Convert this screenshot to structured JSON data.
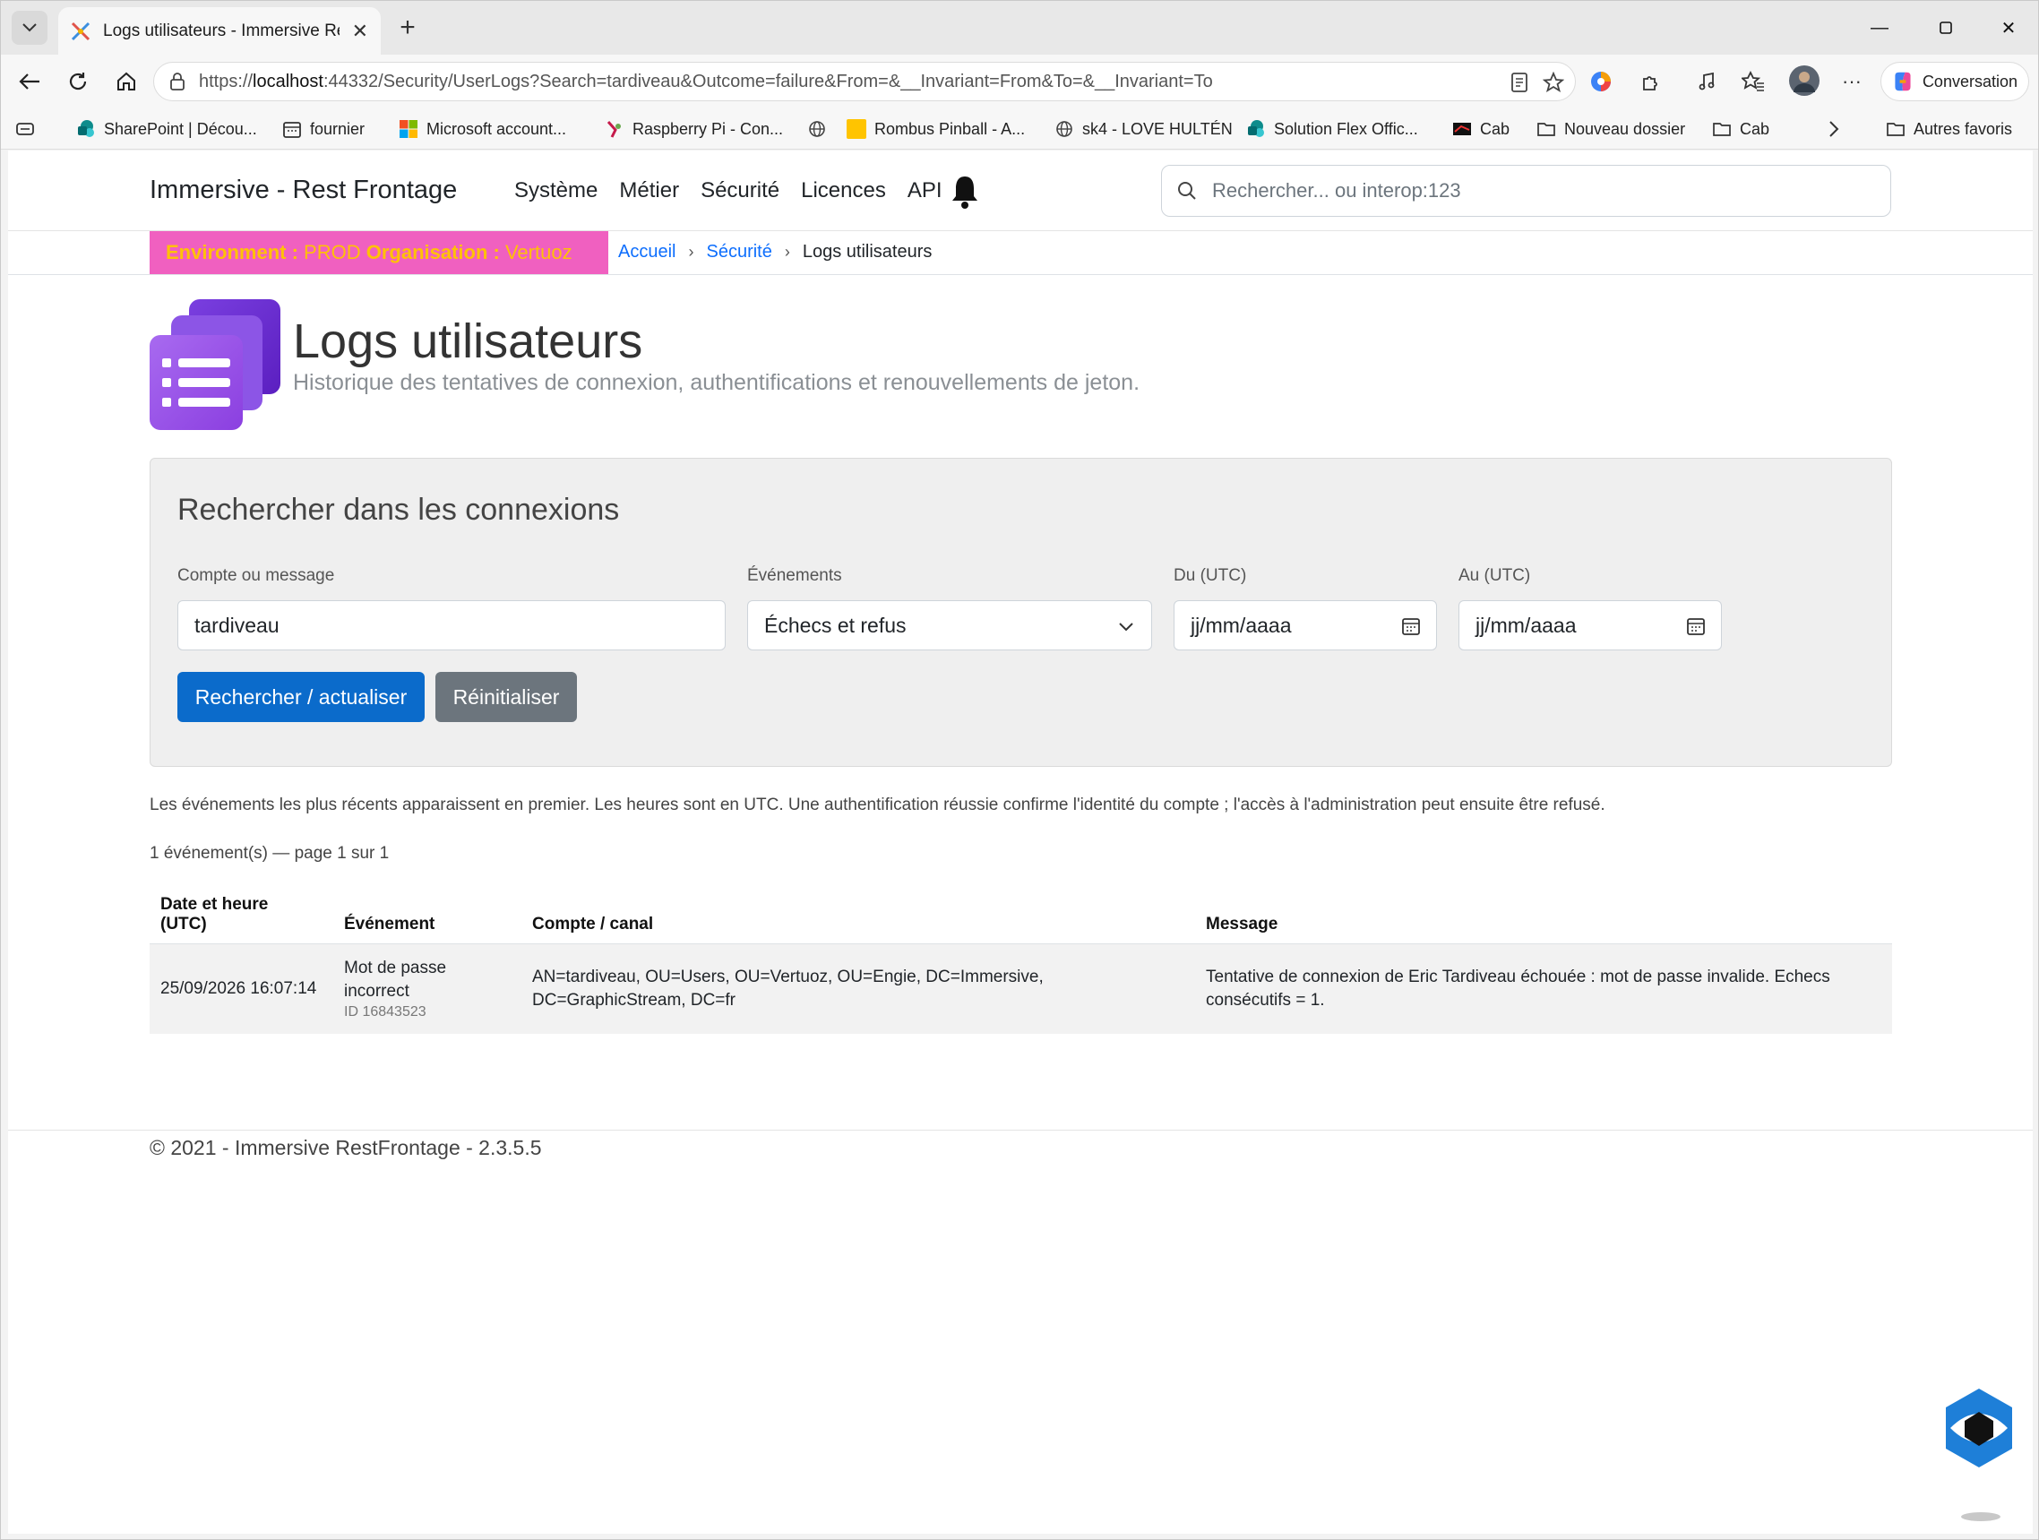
{
  "browser": {
    "tab_title": "Logs utilisateurs - Immersive RestF",
    "url_prefix": "https://",
    "url_host": "localhost",
    "url_rest": ":44332/Security/UserLogs?Search=tardiveau&Outcome=failure&From=&__Invariant=From&To=&__Invariant=To",
    "copilot_label": "Conversation",
    "bookmarks": [
      {
        "label": "SharePoint | Décou...",
        "icon": "sharepoint-icon"
      },
      {
        "label": "fournier",
        "icon": "calendar-icon"
      },
      {
        "label": "Microsoft account...",
        "icon": "microsoft-icon"
      },
      {
        "label": "Raspberry Pi - Con...",
        "icon": "raspberry-icon"
      },
      {
        "label": "",
        "icon": "globe-icon"
      },
      {
        "label": "Rombus Pinball - A...",
        "icon": "yellow-square-icon"
      },
      {
        "label": "sk4 - LOVE HULTÉN",
        "icon": "globe-icon"
      },
      {
        "label": "Solution Flex Offic...",
        "icon": "sharepoint-icon"
      },
      {
        "label": "Cab",
        "icon": "cab-icon"
      },
      {
        "label": "Nouveau dossier",
        "icon": "folder-icon"
      },
      {
        "label": "Cab",
        "icon": "folder-icon"
      }
    ],
    "other_bookmarks": "Autres favoris"
  },
  "app": {
    "brand": "Immersive - Rest Frontage",
    "nav": [
      "Système",
      "Métier",
      "Sécurité",
      "Licences",
      "API"
    ],
    "search_placeholder": "Rechercher... ou interop:123",
    "env_label": "Environment :",
    "env_value": "PROD",
    "org_label": "Organisation :",
    "org_value": "Vertuoz",
    "breadcrumb": [
      "Accueil",
      "Sécurité",
      "Logs utilisateurs"
    ]
  },
  "page": {
    "title": "Logs utilisateurs",
    "subtitle": "Historique des tentatives de connexion, authentifications et renouvellements de jeton."
  },
  "search": {
    "card_title": "Rechercher dans les connexions",
    "account_label": "Compte ou message",
    "account_value": "tardiveau",
    "events_label": "Événements",
    "events_value": "Échecs et refus",
    "from_label": "Du (UTC)",
    "from_placeholder": "jj/mm/aaaa",
    "to_label": "Au (UTC)",
    "to_placeholder": "jj/mm/aaaa",
    "submit_label": "Rechercher / actualiser",
    "reset_label": "Réinitialiser"
  },
  "results": {
    "info": "Les événements les plus récents apparaissent en premier. Les heures sont en UTC. Une authentification réussie confirme l'identité du compte ; l'accès à l'administration peut ensuite être refusé.",
    "count": "1 événement(s) — page 1 sur 1",
    "headers": {
      "date_line1": "Date et heure",
      "date_line2": "(UTC)",
      "event": "Événement",
      "account": "Compte / canal",
      "message": "Message"
    },
    "rows": [
      {
        "date": "25/09/2026 16:07:14",
        "event": "Mot de passe incorrect",
        "id": "ID 16843523",
        "account": "AN=tardiveau, OU=Users, OU=Vertuoz, OU=Engie, DC=Immersive, DC=GraphicStream, DC=fr",
        "message": "Tentative de connexion de Eric Tardiveau échouée : mot de passe invalide. Echecs consécutifs = 1."
      }
    ]
  },
  "footer": "© 2021 - Immersive RestFrontage - 2.3.5.5",
  "colors": {
    "primary": "#0b6bcb",
    "secondary": "#6c757d",
    "env_banner_bg": "#f060c0",
    "env_banner_text": "#ffc107",
    "link": "#0d6efd",
    "icon_purple": "#8b3fe0"
  }
}
